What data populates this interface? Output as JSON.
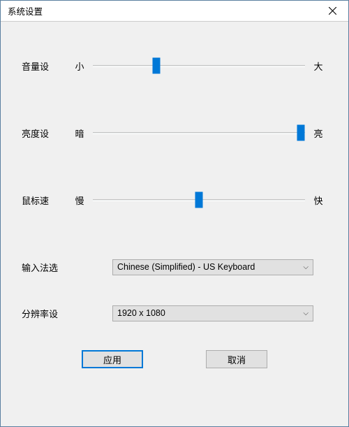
{
  "window": {
    "title": "系统设置"
  },
  "sliders": {
    "volume": {
      "label": "音量设",
      "min_label": "小",
      "max_label": "大",
      "value_pct": 30
    },
    "brightness": {
      "label": "亮度设",
      "min_label": "暗",
      "max_label": "亮",
      "value_pct": 98
    },
    "mouse": {
      "label": "鼠标速",
      "min_label": "慢",
      "max_label": "快",
      "value_pct": 50
    }
  },
  "ime": {
    "label": "输入法选",
    "selected": "Chinese (Simplified) - US Keyboard"
  },
  "resolution": {
    "label": "分辨率设",
    "selected": "1920 x 1080"
  },
  "buttons": {
    "apply": "应用",
    "cancel": "取消"
  }
}
